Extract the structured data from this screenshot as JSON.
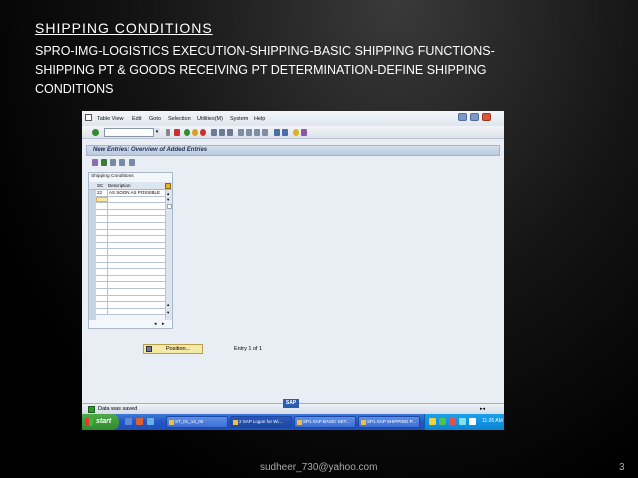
{
  "slide": {
    "title": "SHIPPING CONDITIONS",
    "path_line1": "SPRO-IMG-LOGISTICS EXECUTION-SHIPPING-BASIC SHIPPING FUNCTIONS-",
    "path_line2": "SHIPPING PT & GOODS RECEIVING PT DETERMINATION-DEFINE SHIPPING",
    "path_line3": "CONDITIONS",
    "footer_email": "sudheer_730@yahoo.com",
    "page_number": "3"
  },
  "sap": {
    "menu": [
      "Table View",
      "Edit",
      "Goto",
      "Selection",
      "Utilities(M)",
      "System",
      "Help"
    ],
    "page_title": "New Entries: Overview of Added Entries",
    "table": {
      "caption": "Shipping Conditions",
      "columns": [
        "SC",
        "Description"
      ],
      "rows": [
        {
          "sc": "22",
          "description": "AS SOON AS POSSIBLE"
        }
      ]
    },
    "position_button": "Position...",
    "entry_count": "Entry 1 of 1",
    "status_message": "Data was saved",
    "sap_logo": "SAP"
  },
  "taskbar": {
    "start": "start",
    "tasks": [
      "ST_01_14_00",
      "2 SAP Logon for Wi...",
      "SP1 SAP BASIC SET...",
      "SP1 SAP SHIPPING P..."
    ],
    "clock": "11:26 AM"
  }
}
